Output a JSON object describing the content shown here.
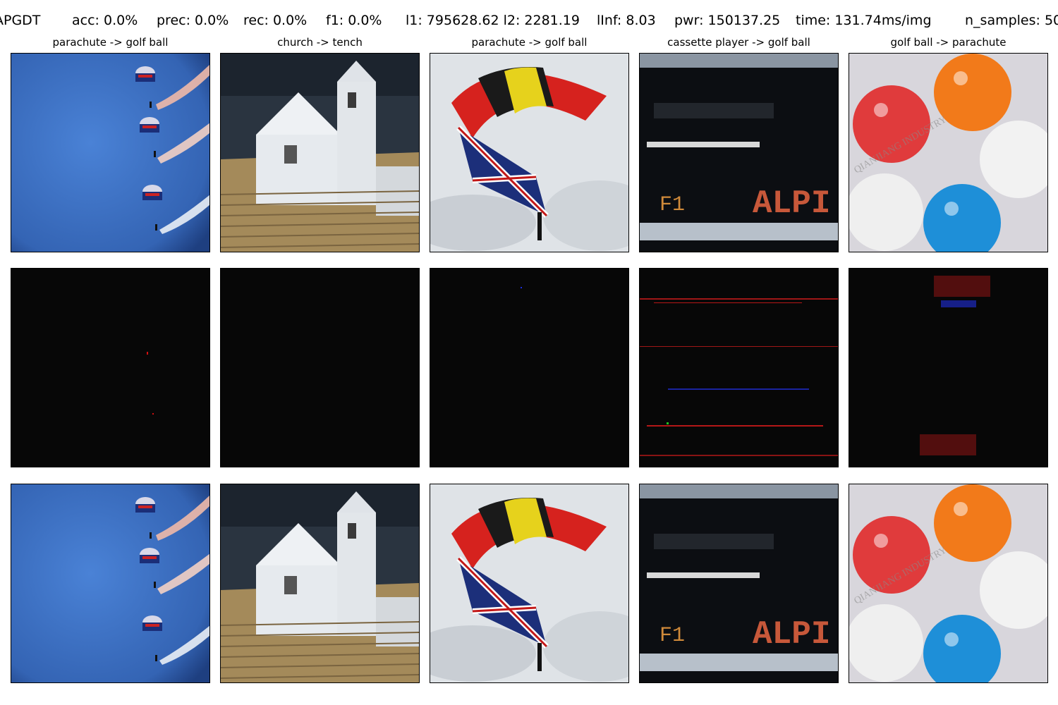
{
  "header": {
    "method": "APGDT",
    "acc": "acc: 0.0%",
    "prec": "prec: 0.0%",
    "rec": "rec: 0.0%",
    "f1": "f1: 0.0%",
    "l1l2": "l1: 795628.62 l2: 2281.19",
    "linf": "lInf: 8.03",
    "pwr": "pwr: 150137.25",
    "time": "time: 131.74ms/img",
    "n_samples": "n_samples: 50"
  },
  "columns": [
    {
      "title": "parachute -> golf ball"
    },
    {
      "title": "church -> tench"
    },
    {
      "title": "parachute -> golf ball"
    },
    {
      "title": "cassette player -> golf ball"
    },
    {
      "title": "golf ball -> parachute"
    }
  ],
  "rows": [
    "original",
    "perturbation",
    "adversarial"
  ],
  "image_text": {
    "display": "ALPI",
    "display_small": "F1",
    "watermark": "QIANJIANG INDUSTRY"
  }
}
